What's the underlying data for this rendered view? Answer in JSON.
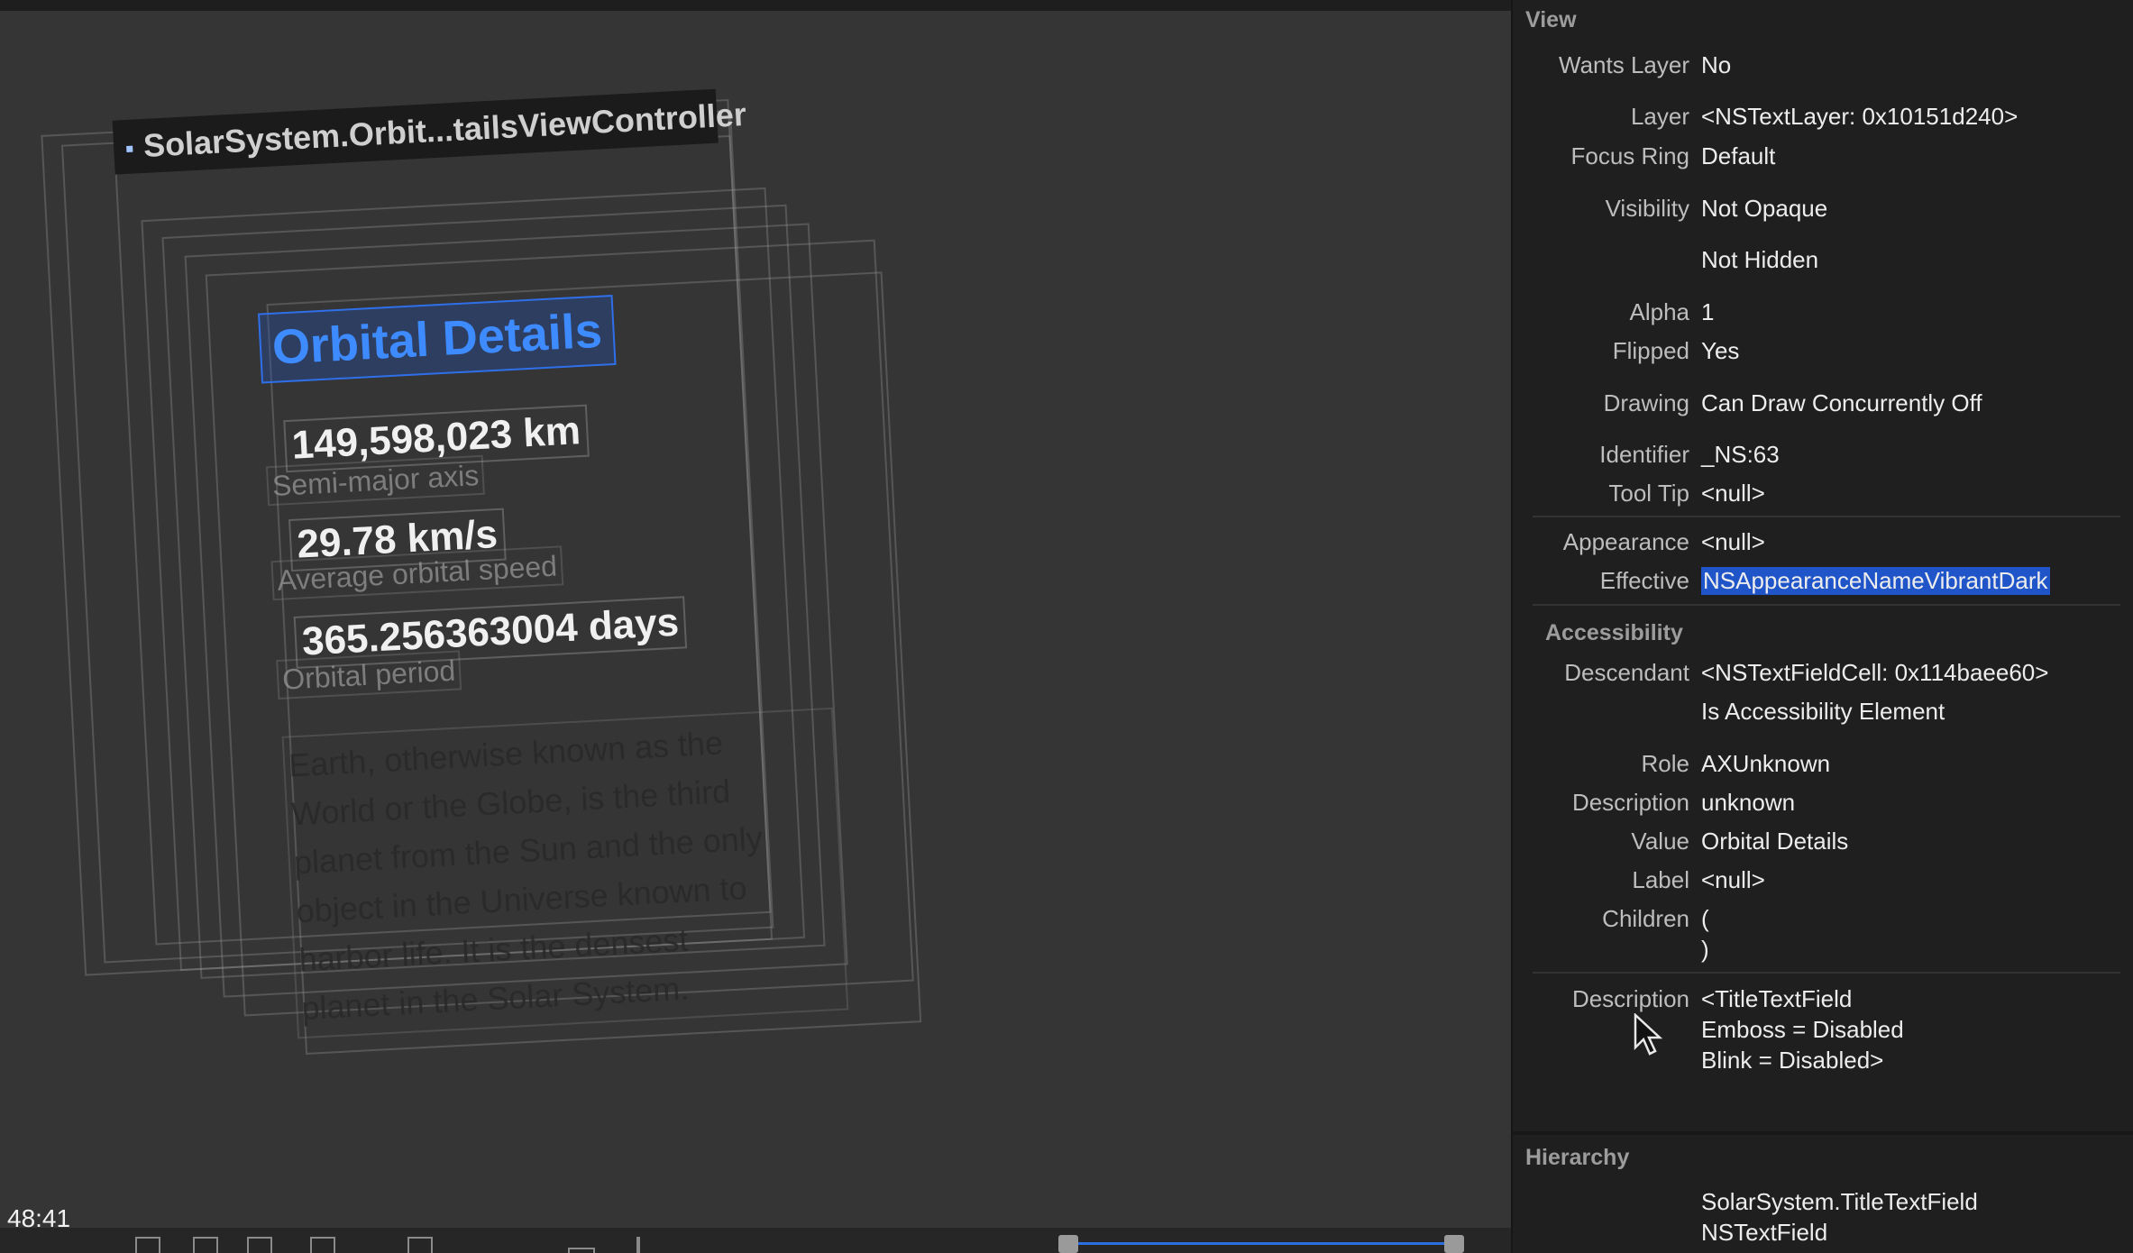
{
  "timer": "48:41",
  "canvas": {
    "controller_label": "SolarSystem.Orbit...tailsViewController",
    "title": "Orbital Details",
    "fields": [
      {
        "value": "149,598,023 km",
        "caption": "Semi-major axis"
      },
      {
        "value": "29.78 km/s",
        "caption": "Average orbital speed"
      },
      {
        "value": "365.256363004 days",
        "caption": "Orbital period"
      }
    ],
    "description_lines": [
      "Earth, otherwise known as the",
      "World or the Globe, is the third",
      "planet from the Sun and the only",
      "object in the Universe known to",
      "harbor life. It is the densest",
      "planet in the Solar System."
    ]
  },
  "inspector": {
    "view_header": "View",
    "wants_layer": {
      "key": "Wants Layer",
      "value": "No"
    },
    "layer": {
      "key": "Layer",
      "value": "<NSTextLayer: 0x10151d240>"
    },
    "focus_ring": {
      "key": "Focus Ring",
      "value": "Default"
    },
    "visibility": {
      "key": "Visibility",
      "value": "Not Opaque",
      "value2": "Not Hidden"
    },
    "alpha": {
      "key": "Alpha",
      "value": "1"
    },
    "flipped": {
      "key": "Flipped",
      "value": "Yes"
    },
    "drawing": {
      "key": "Drawing",
      "value": "Can Draw Concurrently Off"
    },
    "identifier": {
      "key": "Identifier",
      "value": "_NS:63"
    },
    "tool_tip": {
      "key": "Tool Tip",
      "value": "<null>"
    },
    "appearance": {
      "key": "Appearance",
      "value": "<null>"
    },
    "effective": {
      "key": "Effective",
      "value": "NSAppearanceNameVibrantDark"
    },
    "accessibility_header": "Accessibility",
    "descendant": {
      "key": "Descendant",
      "value": "<NSTextFieldCell: 0x114baee60>",
      "value2": "Is Accessibility Element"
    },
    "role": {
      "key": "Role",
      "value": "AXUnknown"
    },
    "ax_description": {
      "key": "Description",
      "value": "unknown"
    },
    "value": {
      "key": "Value",
      "value": "Orbital Details"
    },
    "label": {
      "key": "Label",
      "value": "<null>"
    },
    "children": {
      "key": "Children",
      "value": "(",
      "value2": ")"
    },
    "description": {
      "key": "Description",
      "lines": [
        "<TitleTextField",
        "Emboss = Disabled",
        "Blink = Disabled>"
      ]
    },
    "hierarchy_header": "Hierarchy",
    "hierarchy": [
      "SolarSystem.TitleTextField",
      "NSTextField"
    ]
  },
  "colors": {
    "accent": "#2f6fe8",
    "selection": "#1f55c9",
    "canvas_bg": "#353535",
    "panel_bg": "#1f1f1f"
  }
}
